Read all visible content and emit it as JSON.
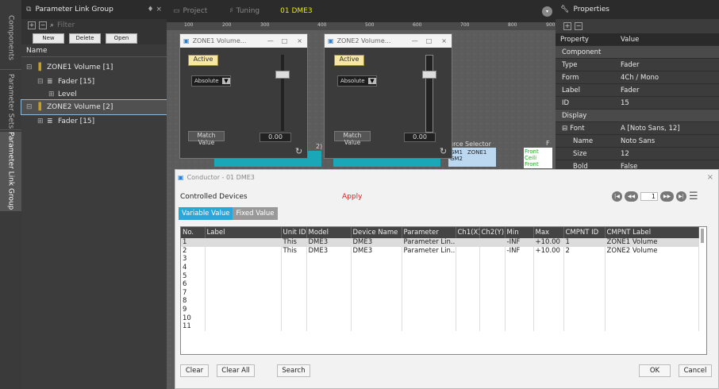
{
  "side_tabs": [
    {
      "label": "Components"
    },
    {
      "label": "Parameter Sets"
    },
    {
      "label": "Parameter Link Group"
    }
  ],
  "link_panel": {
    "title": "Parameter Link Group",
    "pin": "♦ ×",
    "filter_placeholder": "Filter",
    "buttons": {
      "new": "New",
      "delete": "Delete",
      "open": "Open"
    },
    "column": "Name",
    "tree": [
      {
        "label": "ZONE1 Volume [1]",
        "exp": "⊟"
      },
      {
        "label": "Fader [15]",
        "exp": "⊟"
      },
      {
        "label": "Level",
        "exp": "⊞"
      },
      {
        "label": "ZONE2 Volume [2]",
        "exp": "⊟"
      },
      {
        "label": "Fader [15]",
        "exp": "⊞"
      }
    ]
  },
  "tabs": [
    {
      "label": "Project"
    },
    {
      "label": "Tuning"
    },
    {
      "label": "01 DME3"
    }
  ],
  "ruler": [
    "100",
    "200",
    "300",
    "400",
    "500",
    "600",
    "700",
    "800",
    "900"
  ],
  "zone_windows": [
    {
      "title": "ZONE1 Volume...",
      "active": "Active",
      "mode": "Absolute",
      "match": "Match Value",
      "value": "0.00"
    },
    {
      "title": "ZONE2 Volume...",
      "active": "Active",
      "mode": "Absolute",
      "match": "Match Value",
      "value": "0.00"
    }
  ],
  "canvas_labels": {
    "source_selector": "urce Selector",
    "gm1": "GM1",
    "zone1": "ZONE1",
    "gm2": "GM2",
    "pc": "PC",
    "front": "Front",
    "ceil": "Ceili",
    "front2": "Front",
    "f": "F",
    "num2": "2)"
  },
  "properties": {
    "title": "Properties",
    "col_property": "Property",
    "col_value": "Value",
    "rows": [
      {
        "k": "Component",
        "v": "",
        "hdr": true
      },
      {
        "k": "Type",
        "v": "Fader"
      },
      {
        "k": "Form",
        "v": "4Ch / Mono"
      },
      {
        "k": "Label",
        "v": "Fader"
      },
      {
        "k": "ID",
        "v": "15"
      },
      {
        "k": "Display",
        "v": "",
        "hdr": true
      },
      {
        "k": "Font",
        "v": "A  [Noto Sans, 12]",
        "exp": "⊟"
      },
      {
        "k": "Name",
        "v": "Noto Sans",
        "ind": true
      },
      {
        "k": "Size",
        "v": "12",
        "ind": true
      },
      {
        "k": "Bold",
        "v": "False",
        "ind": true
      }
    ]
  },
  "conductor": {
    "title": "Conductor - 01 DME3",
    "controlled_devices": "Controlled Devices",
    "apply": "Apply",
    "page": "1",
    "tab_variable": "Variable Value",
    "tab_fixed": "Fixed Value",
    "headers": [
      "No.",
      "Label",
      "Unit ID",
      "Model",
      "Device Name",
      "Parameter",
      "Ch1(X)",
      "Ch2(Y)",
      "Min",
      "Max",
      "CMPNT ID",
      "CMPNT Label"
    ],
    "rows": [
      [
        "1",
        "",
        "This",
        "DME3",
        "DME3",
        "Parameter Lin...",
        "",
        "",
        "-INF",
        "+10.00",
        "1",
        "ZONE1 Volume"
      ],
      [
        "2",
        "",
        "This",
        "DME3",
        "DME3",
        "Parameter Lin...",
        "",
        "",
        "-INF",
        "+10.00",
        "2",
        "ZONE2 Volume"
      ],
      [
        "3",
        "",
        "",
        "",
        "",
        "",
        "",
        "",
        "",
        "",
        "",
        ""
      ],
      [
        "4",
        "",
        "",
        "",
        "",
        "",
        "",
        "",
        "",
        "",
        "",
        ""
      ],
      [
        "5",
        "",
        "",
        "",
        "",
        "",
        "",
        "",
        "",
        "",
        "",
        ""
      ],
      [
        "6",
        "",
        "",
        "",
        "",
        "",
        "",
        "",
        "",
        "",
        "",
        ""
      ],
      [
        "7",
        "",
        "",
        "",
        "",
        "",
        "",
        "",
        "",
        "",
        "",
        ""
      ],
      [
        "8",
        "",
        "",
        "",
        "",
        "",
        "",
        "",
        "",
        "",
        "",
        ""
      ],
      [
        "9",
        "",
        "",
        "",
        "",
        "",
        "",
        "",
        "",
        "",
        "",
        ""
      ],
      [
        "10",
        "",
        "",
        "",
        "",
        "",
        "",
        "",
        "",
        "",
        "",
        ""
      ],
      [
        "11",
        "",
        "",
        "",
        "",
        "",
        "",
        "",
        "",
        "",
        "",
        ""
      ]
    ],
    "clear": "Clear",
    "clear_all": "Clear All",
    "search": "Search",
    "ok": "OK",
    "cancel": "Cancel"
  },
  "colors": {
    "accent": "#2aa6d8",
    "apply": "#e0202a",
    "yellow_tab": "#e8e800"
  }
}
